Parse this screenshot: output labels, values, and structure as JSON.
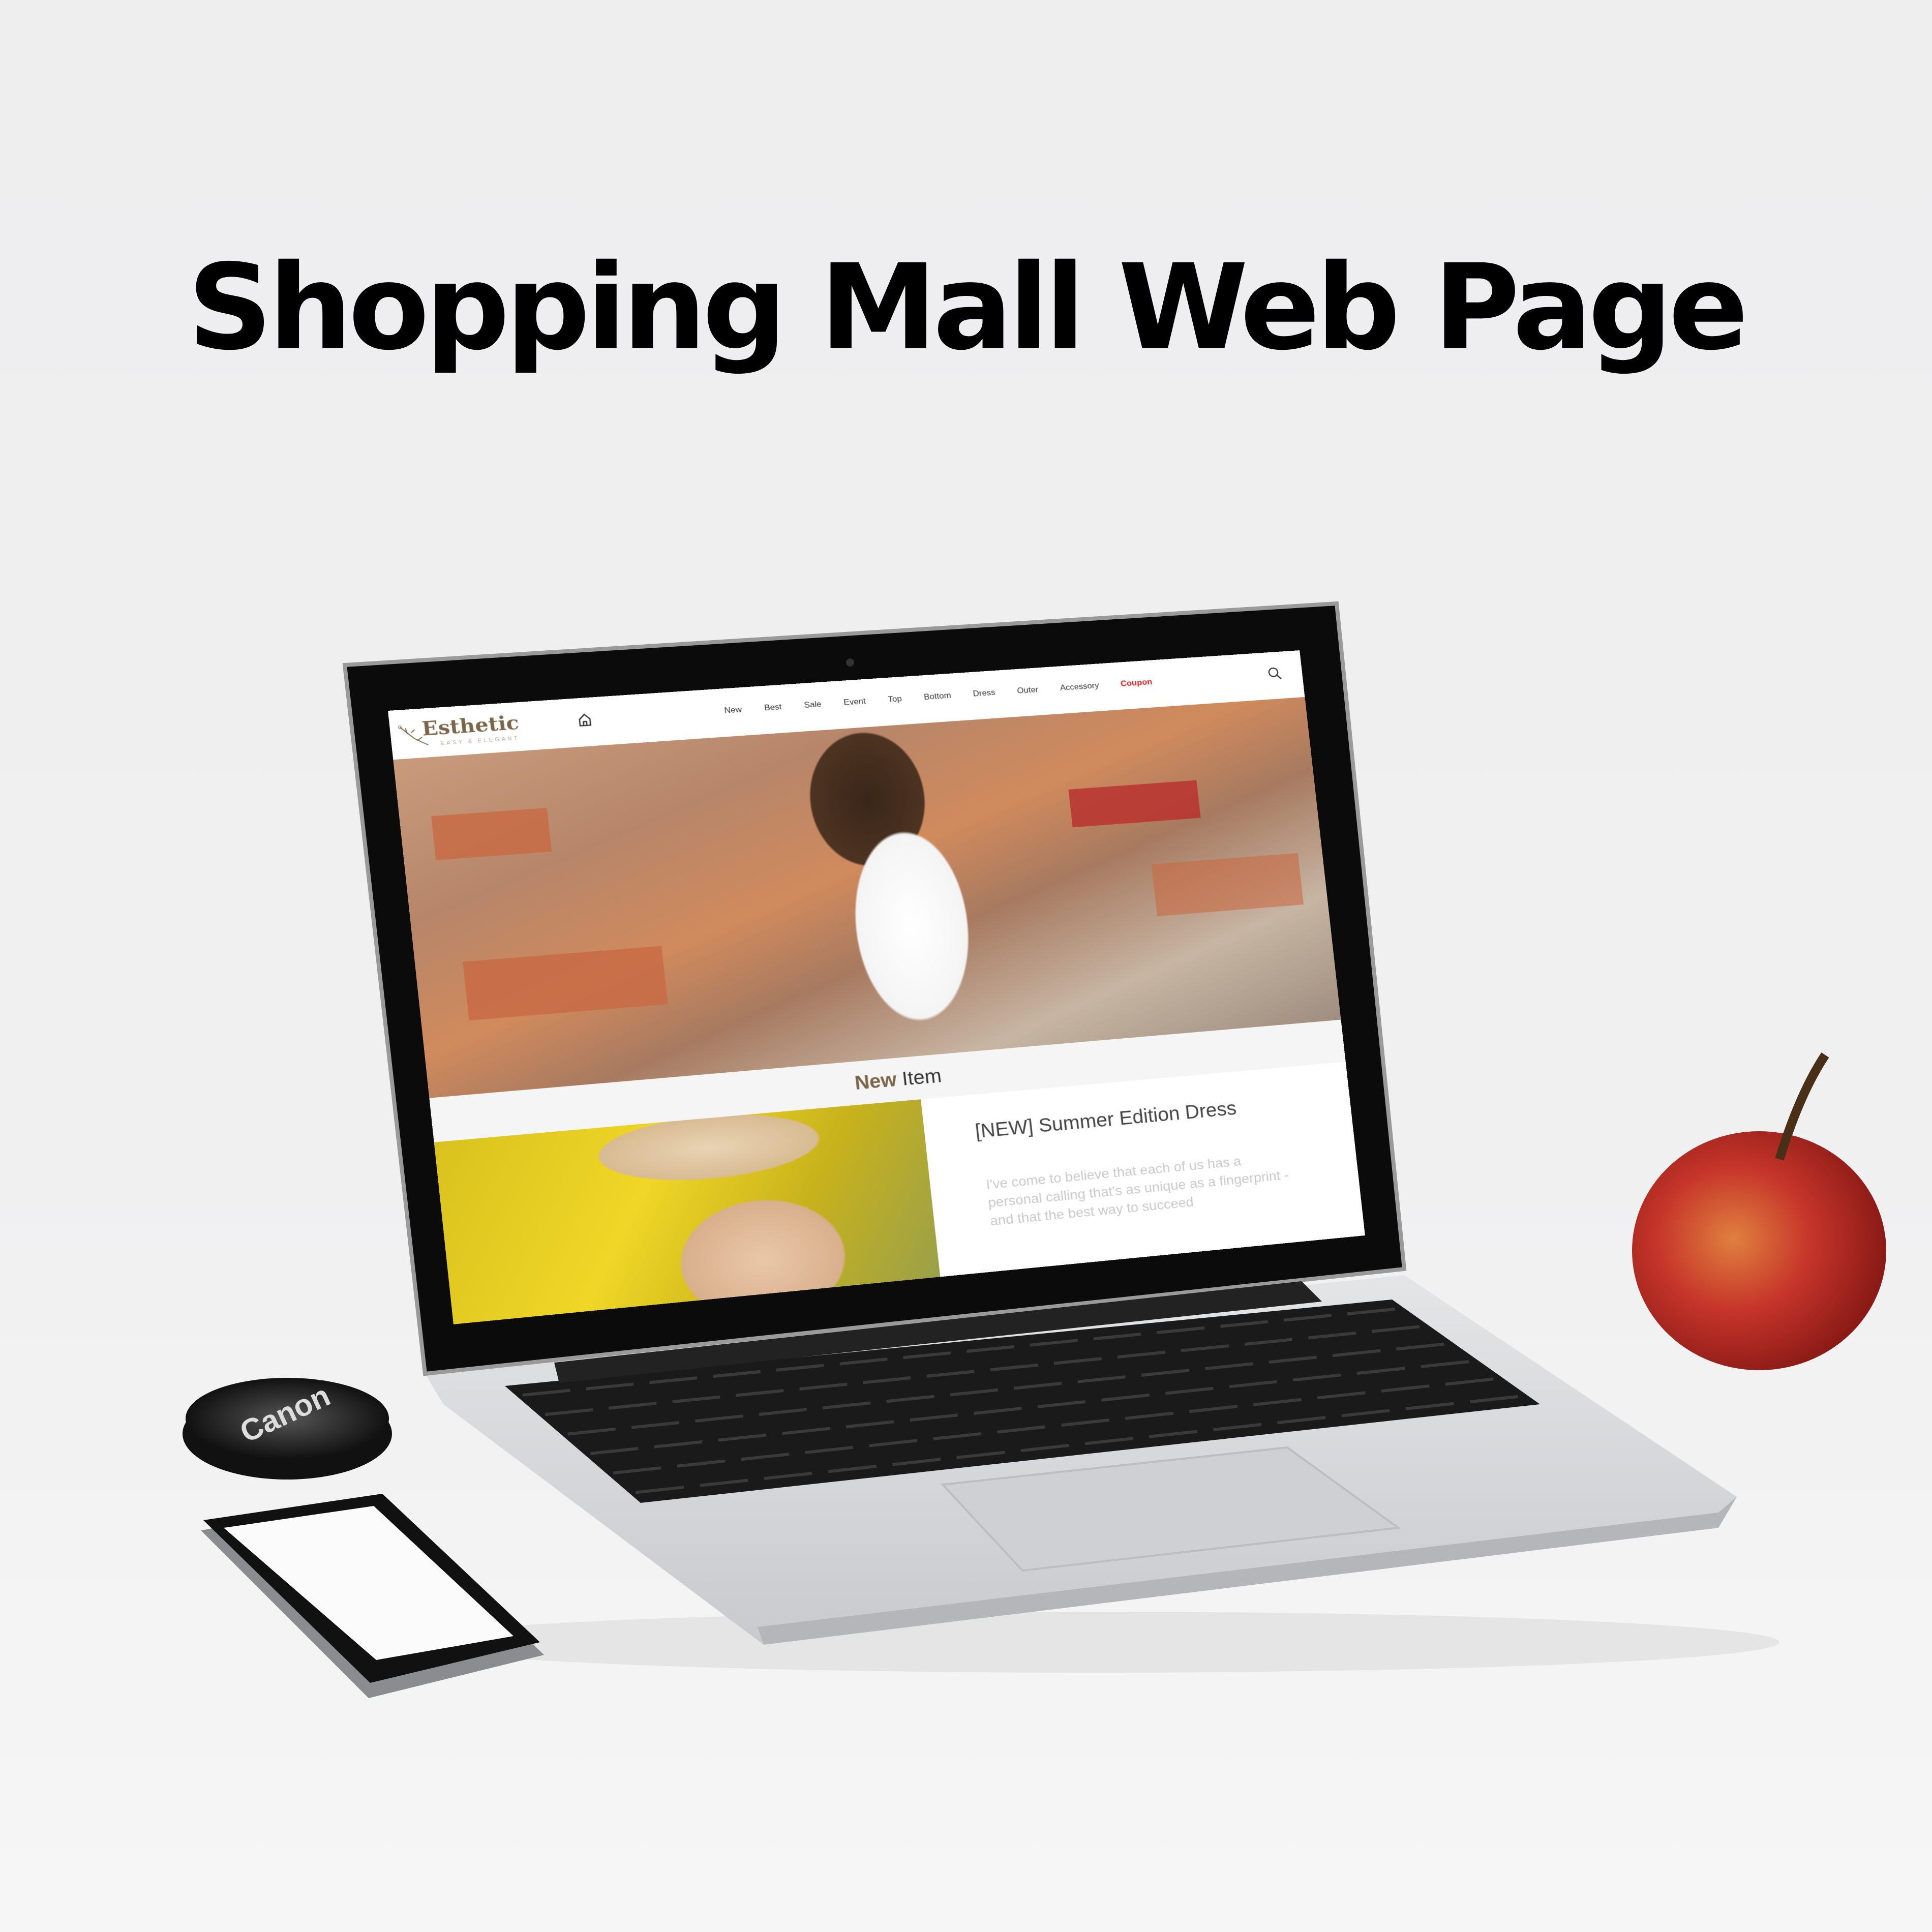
{
  "heading": "Shopping Mall Web Page",
  "website": {
    "logo": {
      "name": "Esthetic",
      "tagline": "EASY & ELEGANT"
    },
    "nav": {
      "items": [
        "New",
        "Best",
        "Sale",
        "Event",
        "Top",
        "Bottom",
        "Dress",
        "Outer",
        "Accessory"
      ],
      "coupon": "Coupon"
    },
    "section": {
      "title_part1": "New",
      "title_part2": " Item"
    },
    "product": {
      "title": "[NEW] Summer Edition Dress",
      "description": "I've come to believe that each of us has a personal calling that's as unique as a fingerprint - and that the best way to succeed"
    },
    "colors": {
      "brand": "#7b6548",
      "coupon": "#e61919"
    }
  },
  "props": {
    "lens_cap_brand": "Canon"
  }
}
